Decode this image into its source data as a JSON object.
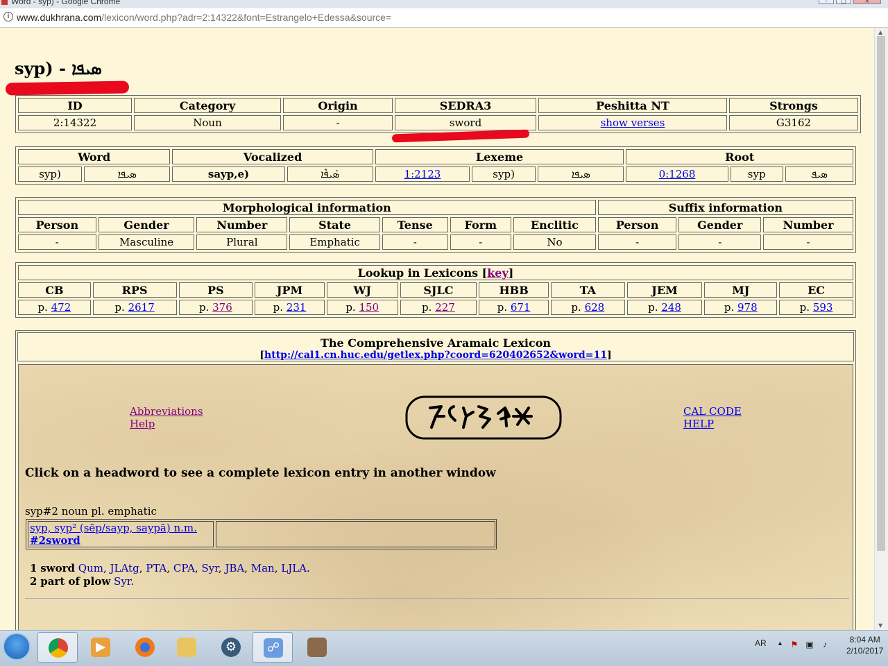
{
  "browser": {
    "tab_title": "Word - syp) - Google Chrome",
    "url_host": "www.dukhrana.com",
    "url_path": "/lexicon/word.php?adr=2:14322&font=Estrangelo+Edessa&source="
  },
  "heading": {
    "latin": "syp) - ",
    "syriac": "ܣܝܦܐ"
  },
  "info_table": {
    "headers": [
      "ID",
      "Category",
      "Origin",
      "SEDRA3",
      "Peshitta NT",
      "Strongs"
    ],
    "values": [
      "2:14322",
      "Noun",
      "-",
      "sword",
      "show verses",
      "G3162"
    ]
  },
  "word_table": {
    "headers": [
      "Word",
      "Vocalized",
      "Lexeme",
      "Root"
    ],
    "word_latin": "syp)",
    "word_syriac": "ܣܝܦܐ",
    "vocalized_latin": "sayp,e)",
    "vocalized_syriac": "ܣܰܝܦܶܐ",
    "lexeme_id": "1:2123",
    "lexeme_latin": "syp)",
    "lexeme_syriac": "ܣܝܦܐ",
    "root_id": "0:1268",
    "root_latin": "syp",
    "root_syriac": "ܣܝܦ"
  },
  "morph_table": {
    "group1": "Morphological information",
    "group2": "Suffix information",
    "headers": [
      "Person",
      "Gender",
      "Number",
      "State",
      "Tense",
      "Form",
      "Enclitic",
      "Person",
      "Gender",
      "Number"
    ],
    "values": [
      "-",
      "Masculine",
      "Plural",
      "Emphatic",
      "-",
      "-",
      "No",
      "-",
      "-",
      "-"
    ]
  },
  "lexicon_table": {
    "title": "Lookup in Lexicons [",
    "key": "key",
    "title_end": "]",
    "prefix": "p.",
    "headers": [
      "CB",
      "RPS",
      "PS",
      "JPM",
      "WJ",
      "SJLC",
      "HBB",
      "TA",
      "JEM",
      "MJ",
      "EC"
    ],
    "pages": [
      "472",
      "2617",
      "376",
      "231",
      "150",
      "227",
      "671",
      "628",
      "248",
      "978",
      "593"
    ]
  },
  "cal": {
    "title": "The Comprehensive Aramaic Lexicon",
    "link_open": "[",
    "link": "http://cal1.cn.huc.edu/getlex.php?coord=620402652&word=11",
    "link_close": "]",
    "abbreviations": "Abbreviations",
    "help": "Help",
    "cal_code": "CAL CODE",
    "help_caps": "HELP",
    "instruction": "Click on a headword to see a complete lexicon entry in another window",
    "entry_label": "syp#2 noun pl. emphatic",
    "entry_link": "syp, syp² (sēp/sayp, saypā) n.m.",
    "entry_link2": "#2sword",
    "sense1_num": "1",
    "sense1_word": "sword",
    "sense1_dialects": [
      "Qum",
      "JLAtg",
      "PTA",
      "CPA",
      "Syr",
      "JBA",
      "Man",
      "LJLA"
    ],
    "sense2_num": "2",
    "sense2_word": "part of plow",
    "sense2_dialect": "Syr."
  },
  "taskbar": {
    "lang": "AR",
    "time": "8:04 AM",
    "date": "2/10/2017"
  }
}
